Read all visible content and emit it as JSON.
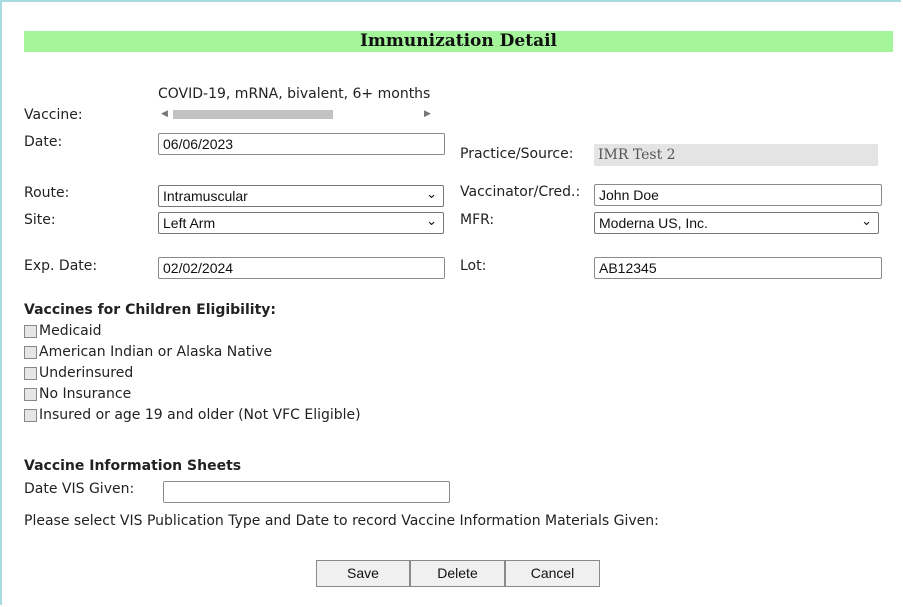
{
  "header": {
    "title": "Immunization Detail"
  },
  "fields": {
    "vaccine": {
      "label": "Vaccine:",
      "value": "COVID-19, mRNA, bivalent, 6+ months"
    },
    "date": {
      "label": "Date:",
      "value": "06/06/2023"
    },
    "practice": {
      "label": "Practice/Source:",
      "value": "IMR Test 2"
    },
    "route": {
      "label": "Route:",
      "value": "Intramuscular"
    },
    "vaccinator": {
      "label": "Vaccinator/Cred.:",
      "value": "John Doe"
    },
    "site": {
      "label": "Site:",
      "value": "Left Arm"
    },
    "mfr": {
      "label": "MFR:",
      "value": "Moderna US, Inc."
    },
    "exp_date": {
      "label": "Exp. Date:",
      "value": "02/02/2024"
    },
    "lot": {
      "label": "Lot:",
      "value": "AB12345"
    }
  },
  "vfc": {
    "heading": "Vaccines for Children Eligibility:",
    "options": [
      {
        "label": "Medicaid",
        "checked": false
      },
      {
        "label": "American Indian or Alaska Native",
        "checked": false
      },
      {
        "label": "Underinsured",
        "checked": false
      },
      {
        "label": "No Insurance",
        "checked": false
      },
      {
        "label": "Insured or age 19 and older (Not VFC Eligible)",
        "checked": false
      }
    ]
  },
  "vis": {
    "heading": "Vaccine Information Sheets",
    "date_label": "Date VIS Given:",
    "date_value": "",
    "note": "Please select VIS Publication Type and Date to record Vaccine Information Materials Given:"
  },
  "buttons": {
    "save": "Save",
    "delete": "Delete",
    "cancel": "Cancel"
  },
  "icons": {
    "dropdown": "chevron-down-icon",
    "scroll_left": "arrow-left-icon",
    "scroll_right": "arrow-right-icon"
  },
  "colors": {
    "header_bg": "#a4f59a",
    "frame_border": "#a9dadf",
    "readonly_bg": "#e4e4e4"
  }
}
